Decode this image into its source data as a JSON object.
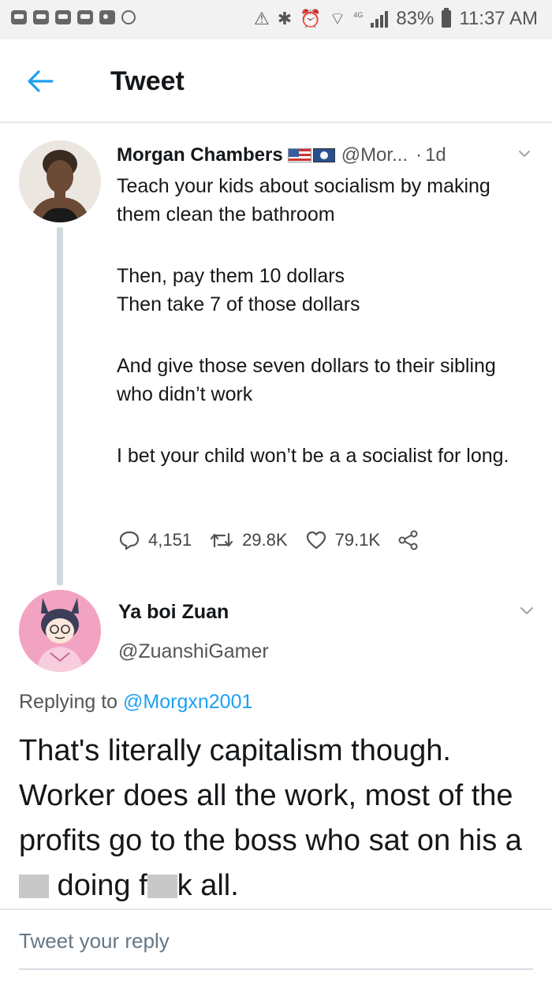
{
  "status_bar": {
    "network_tag": "4G",
    "battery": "83%",
    "time": "11:37 AM"
  },
  "header": {
    "title": "Tweet"
  },
  "original_tweet": {
    "display_name": "Morgan Chambers",
    "handle": "@Mor...",
    "separator": "·",
    "time": "1d",
    "text_paragraphs": [
      "Teach your kids about socialism by making them clean the bathroom",
      "Then, pay them 10 dollars\nThen take 7 of those dollars",
      "And give those seven dollars to their sibling who didn’t work",
      "I bet your child won’t be a a socialist for long."
    ],
    "replies": "4,151",
    "retweets": "29.8K",
    "likes": "79.1K"
  },
  "reply_tweet": {
    "display_name": "Ya boi Zuan",
    "handle": "@ZuanshiGamer",
    "replying_prefix": "Replying to",
    "replying_to": "@Morgxn2001",
    "text_parts": {
      "a": "That's literally capitalism though. Worker does all the work, most of the profits go to the boss who sat on his a",
      "b": " doing f",
      "c": "k all."
    }
  },
  "compose": {
    "placeholder": "Tweet your reply"
  },
  "colors": {
    "accent": "#1da1f2",
    "text": "#14171a",
    "muted": "#657786",
    "divider": "#e1e8ed"
  }
}
